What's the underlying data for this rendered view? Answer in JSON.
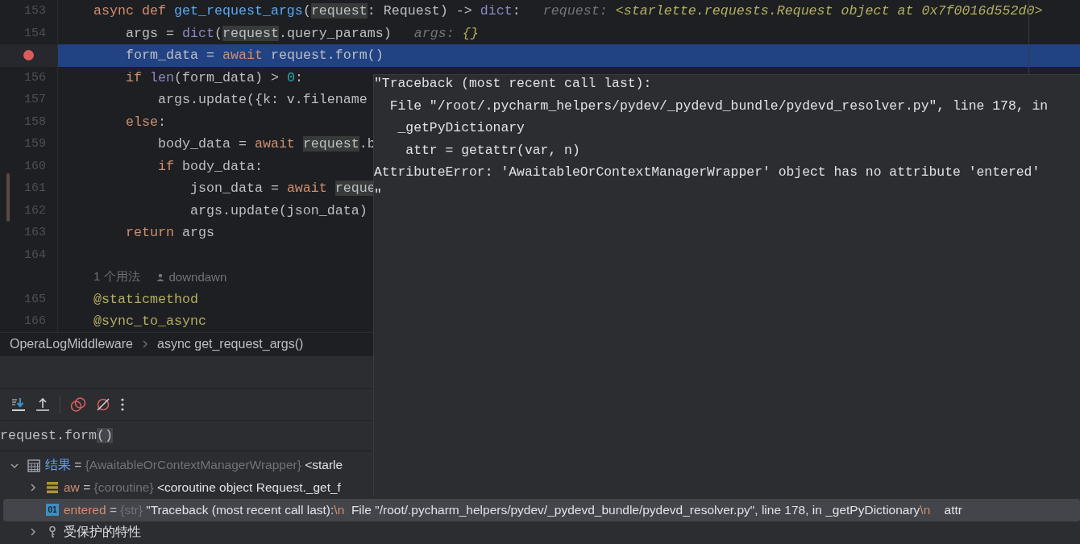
{
  "editor": {
    "lines": [
      {
        "kind": "code",
        "number": "153",
        "breakpoint": false,
        "current": false,
        "tokens": [
          {
            "text": "    async def ",
            "kind": "keyword"
          },
          {
            "text": "get_request_args",
            "kind": "func"
          },
          {
            "text": "(",
            "kind": "plain"
          },
          {
            "text": "request",
            "kind": "ref"
          },
          {
            "text": ": Request) -> ",
            "kind": "plain"
          },
          {
            "text": "dict",
            "kind": "builtin"
          },
          {
            "text": ":",
            "kind": "plain"
          }
        ],
        "hint": [
          {
            "text": "request: ",
            "kind": "hint-name"
          },
          {
            "text": "<starlette.requests.Request object at 0x7f0016d552d0>",
            "kind": "hint-value"
          }
        ]
      },
      {
        "kind": "code",
        "number": "154",
        "breakpoint": false,
        "current": false,
        "tokens": [
          {
            "text": "        args = ",
            "kind": "plain"
          },
          {
            "text": "dict",
            "kind": "builtin"
          },
          {
            "text": "(",
            "kind": "plain"
          },
          {
            "text": "request",
            "kind": "ref"
          },
          {
            "text": ".query_params)",
            "kind": "plain"
          }
        ],
        "hint": [
          {
            "text": "args: ",
            "kind": "hint-name"
          },
          {
            "text": "{}",
            "kind": "hint-value"
          }
        ]
      },
      {
        "kind": "code",
        "breakpoint": true,
        "current": true,
        "tokens": [
          {
            "text": "        form_data = ",
            "kind": "plain"
          },
          {
            "text": "await",
            "kind": "keyword"
          },
          {
            "text": " request.form()",
            "kind": "plain"
          }
        ]
      },
      {
        "kind": "code",
        "number": "156",
        "breakpoint": false,
        "current": false,
        "tokens": [
          {
            "text": "        if ",
            "kind": "keyword"
          },
          {
            "text": "len",
            "kind": "builtin"
          },
          {
            "text": "(form_data) > ",
            "kind": "plain"
          },
          {
            "text": "0",
            "kind": "number"
          },
          {
            "text": ":",
            "kind": "plain"
          }
        ]
      },
      {
        "kind": "code",
        "number": "157",
        "breakpoint": false,
        "current": false,
        "tokens": [
          {
            "text": "            args.update({k: v.filename",
            "kind": "plain"
          }
        ]
      },
      {
        "kind": "code",
        "number": "158",
        "breakpoint": false,
        "current": false,
        "tokens": [
          {
            "text": "        else",
            "kind": "keyword"
          },
          {
            "text": ":",
            "kind": "plain"
          }
        ]
      },
      {
        "kind": "code",
        "number": "159",
        "breakpoint": false,
        "current": false,
        "tokens": [
          {
            "text": "            body_data = ",
            "kind": "plain"
          },
          {
            "text": "await ",
            "kind": "keyword"
          },
          {
            "text": "request",
            "kind": "ref"
          },
          {
            "text": ".b",
            "kind": "plain"
          }
        ]
      },
      {
        "kind": "code",
        "number": "160",
        "breakpoint": false,
        "current": false,
        "tokens": [
          {
            "text": "            if",
            "kind": "keyword"
          },
          {
            "text": " body_data:",
            "kind": "plain"
          }
        ]
      },
      {
        "kind": "code",
        "number": "161",
        "breakpoint": false,
        "current": false,
        "tokens": [
          {
            "text": "                json_data = ",
            "kind": "plain"
          },
          {
            "text": "await ",
            "kind": "keyword"
          },
          {
            "text": "reque",
            "kind": "ref"
          }
        ]
      },
      {
        "kind": "code",
        "number": "162",
        "breakpoint": false,
        "current": false,
        "tokens": [
          {
            "text": "                args.update(json_data)",
            "kind": "plain"
          }
        ]
      },
      {
        "kind": "code",
        "number": "163",
        "breakpoint": false,
        "current": false,
        "tokens": [
          {
            "text": "        return",
            "kind": "keyword"
          },
          {
            "text": " args",
            "kind": "plain"
          }
        ]
      },
      {
        "kind": "code",
        "number": "164",
        "breakpoint": false,
        "current": false
      },
      {
        "kind": "usages",
        "usages": "1 个用法",
        "author": "downdawn"
      },
      {
        "kind": "code",
        "number": "165",
        "breakpoint": false,
        "current": false,
        "tokens": [
          {
            "text": "    @staticmethod",
            "kind": "decorator"
          }
        ]
      },
      {
        "kind": "code",
        "number": "166",
        "breakpoint": false,
        "current": false,
        "tokens": [
          {
            "text": "    @sync_to_async",
            "kind": "decorator"
          }
        ]
      }
    ]
  },
  "breadcrumb": [
    "OperaLogMiddleware",
    "async get_request_args()"
  ],
  "tooltip": {
    "lines": [
      "\"Traceback (most recent call last):",
      "  File \"/root/.pycharm_helpers/pydev/_pydevd_bundle/pydevd_resolver.py\", line 178, in",
      "   _getPyDictionary",
      "    attr = getattr(var, n)",
      "AttributeError: 'AwaitableOrContextManagerWrapper' object has no attribute 'entered'",
      "\""
    ]
  },
  "debugger": {
    "expression": [
      {
        "text": "request.form",
        "kind": "plain"
      },
      {
        "text": "()",
        "kind": "brace-match"
      }
    ],
    "tree": {
      "items": [
        {
          "kind": "object",
          "name": "结果",
          "equals": "=",
          "type": "{AwaitableOrContextManagerWrapper}",
          "value": [
            {
              "text": "<starle",
              "kind": "text"
            }
          ],
          "expanded": true,
          "selected": false,
          "children": [
            {
              "kind": "coroutine",
              "name": "aw",
              "equals": "=",
              "type": "{coroutine}",
              "value": [
                {
                  "text": "<coroutine object Request._get_f",
                  "kind": "text"
                }
              ],
              "expanded": false,
              "selected": false
            },
            {
              "kind": "string",
              "badge": "01",
              "name": "entered",
              "equals": "=",
              "type": "{str}",
              "value": [
                {
                  "text": "\"Traceback (most recent call last):",
                  "kind": "text"
                },
                {
                  "text": "\\n",
                  "kind": "escape"
                },
                {
                  "text": "  File \"/root/.pycharm_helpers/pydev/_pydevd_bundle/pydevd_resolver.py\", line 178, in _getPyDictionary",
                  "kind": "text"
                },
                {
                  "text": "\\n",
                  "kind": "escape"
                },
                {
                  "text": "    attr",
                  "kind": "text"
                }
              ],
              "selected": true
            },
            {
              "kind": "protected",
              "name": "受保护的特性",
              "expanded": false,
              "selected": false
            }
          ]
        }
      ]
    }
  }
}
